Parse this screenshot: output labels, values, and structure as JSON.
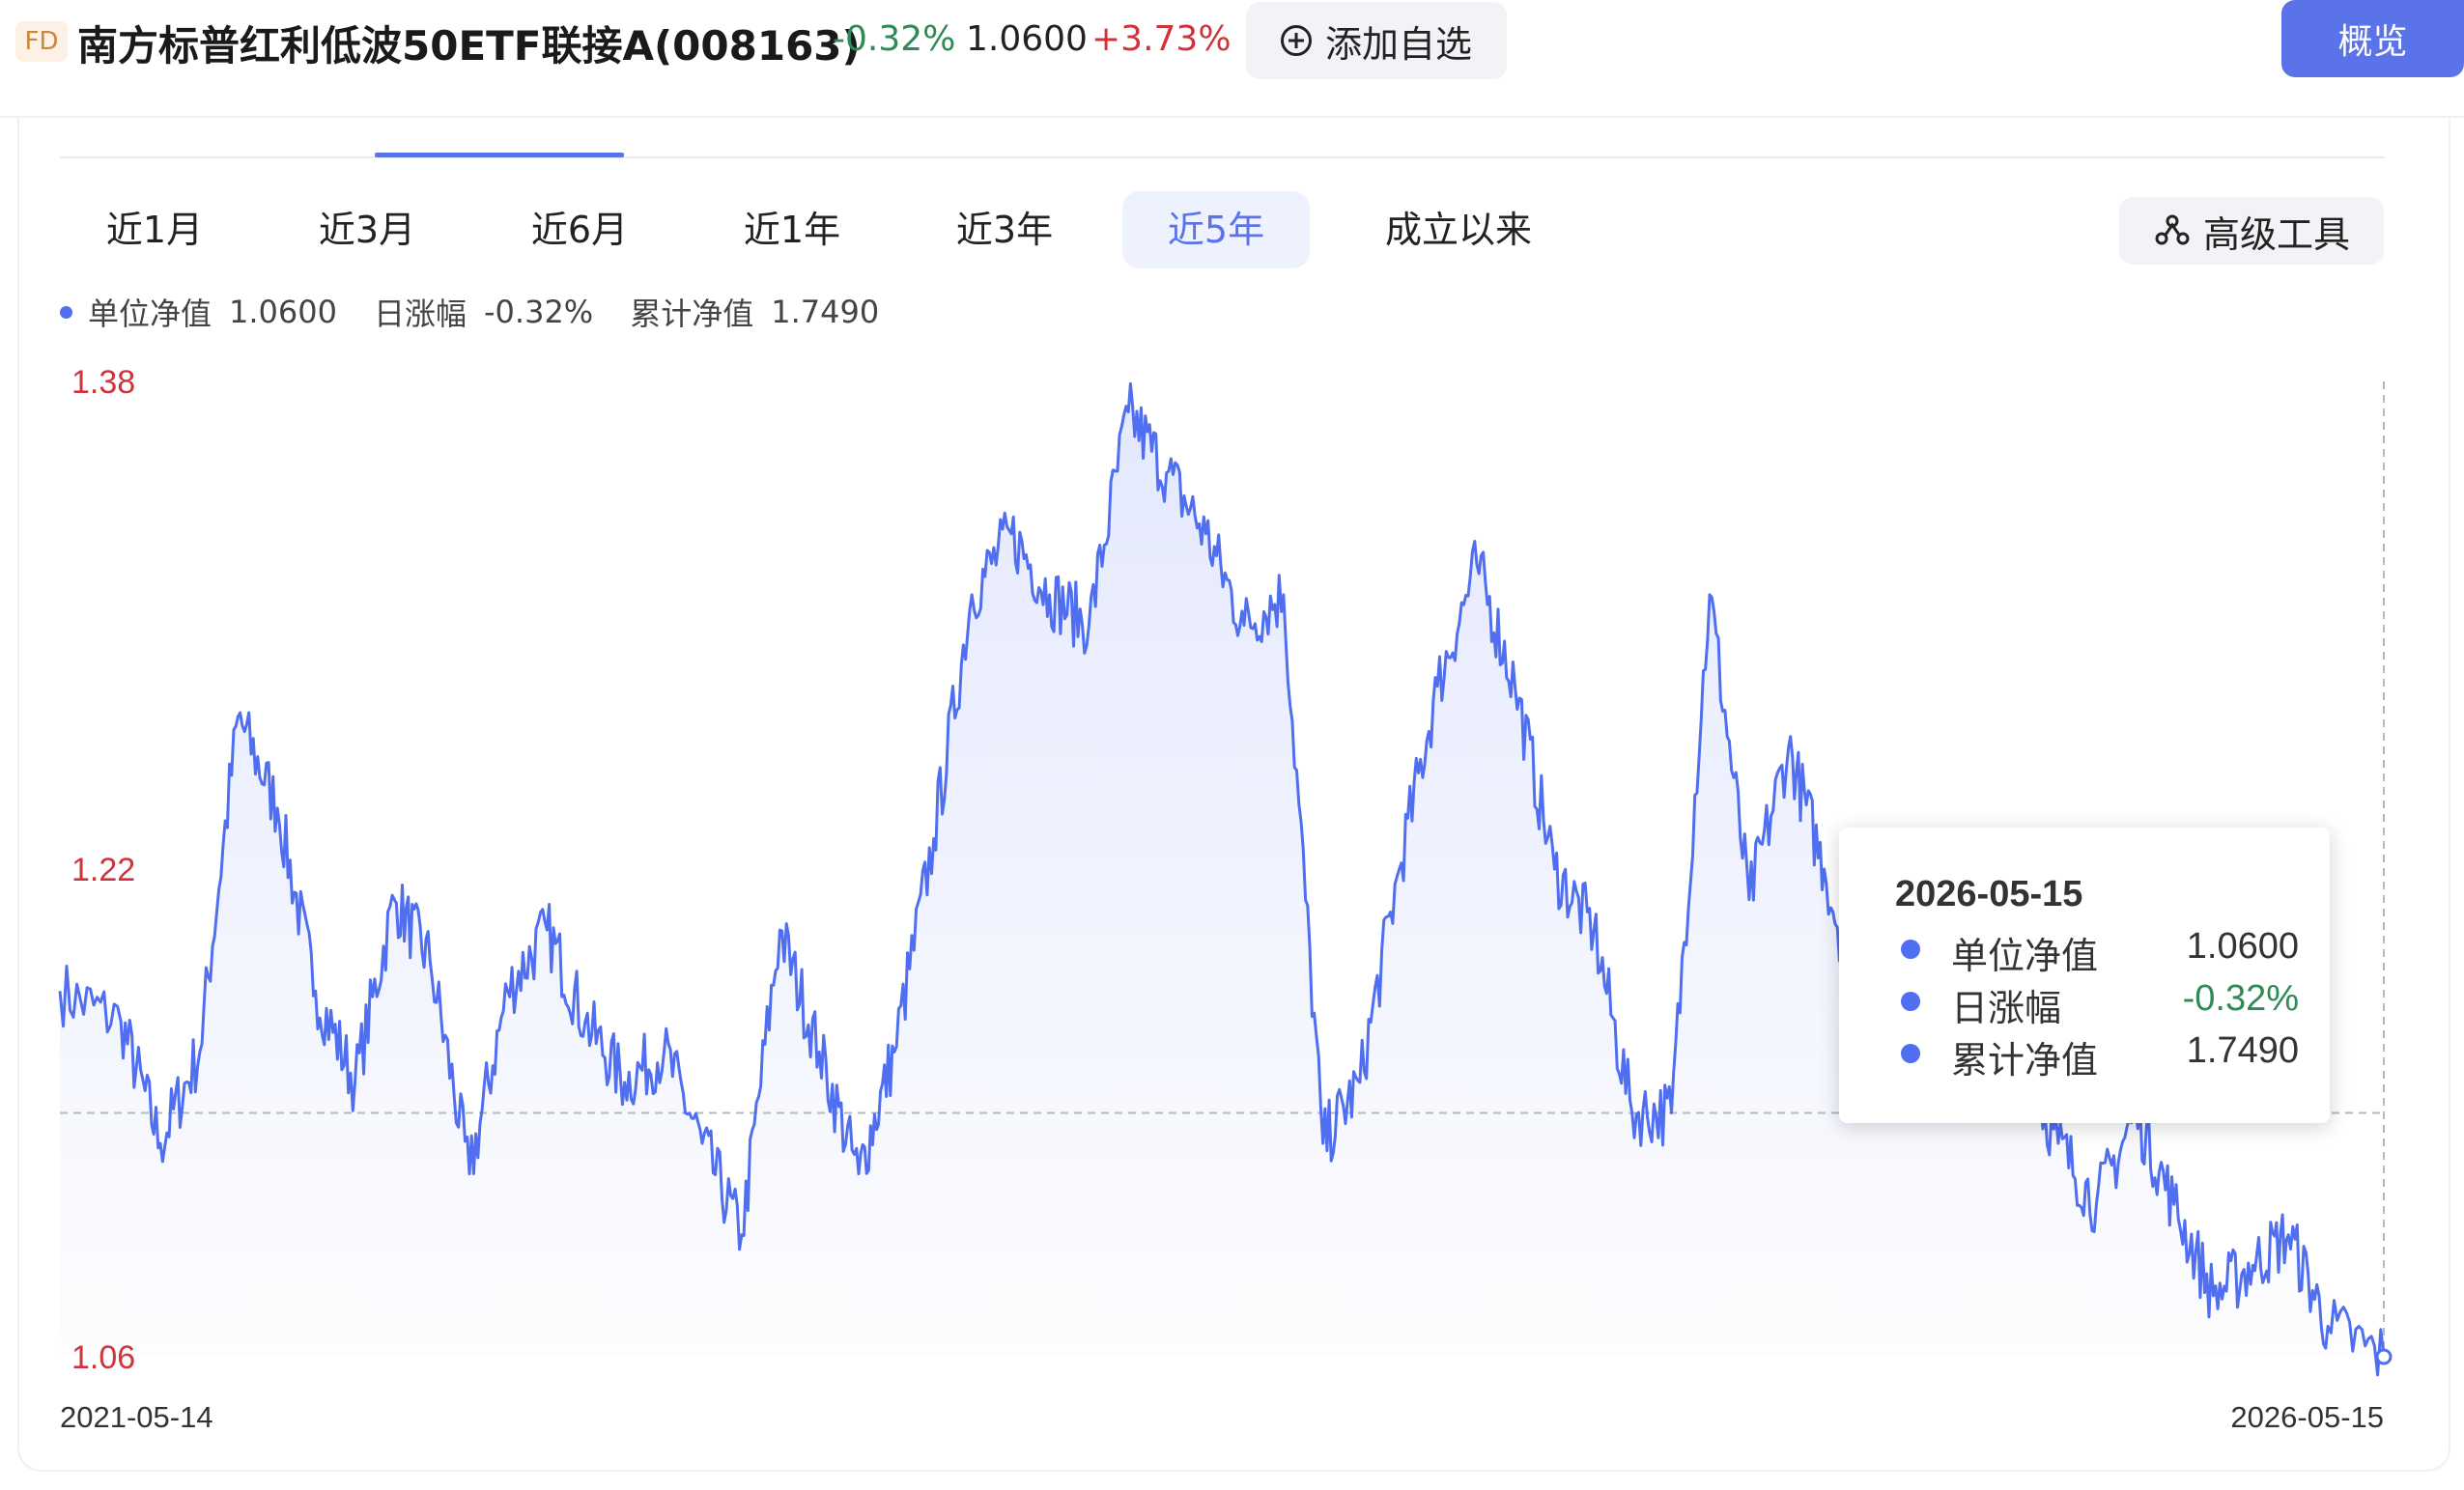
{
  "header": {
    "badge": "FD",
    "fund_title": "南方标普红利低波50ETF联接A(008163)",
    "change_pct": "-0.32%",
    "nav": "1.0600",
    "period_return": "+3.73%",
    "add_watchlist": "添加自选",
    "overview": "概览"
  },
  "range_tabs": [
    {
      "label": "近1月"
    },
    {
      "label": "近3月"
    },
    {
      "label": "近6月"
    },
    {
      "label": "近1年"
    },
    {
      "label": "近3年"
    },
    {
      "label": "近5年",
      "active": true
    },
    {
      "label": "成立以来"
    }
  ],
  "advanced_tool": "高级工具",
  "legend": {
    "unit_nav_label": "单位净值",
    "unit_nav_value": "1.0600",
    "daily_change_label": "日涨幅",
    "daily_change_value": "-0.32%",
    "cum_nav_label": "累计净值",
    "cum_nav_value": "1.7490"
  },
  "tooltip": {
    "date": "2026-05-15",
    "unit_nav_label": "单位净值",
    "unit_nav_value": "1.0600",
    "daily_change_label": "日涨幅",
    "daily_change_value": "-0.32%",
    "cum_nav_label": "累计净值",
    "cum_nav_value": "1.7490"
  },
  "colors": {
    "line": "#4f6ef0",
    "accent": "#5b73e8",
    "up": "#d0333b",
    "down": "#2e8b57"
  },
  "chart_data": {
    "type": "area",
    "series": [
      {
        "x": [
          "2021-05-14",
          "2021-07-01",
          "2021-08-01",
          "2021-09-01",
          "2021-10-01",
          "2021-11-01",
          "2021-12-01",
          "2022-01-01",
          "2022-02-01",
          "2022-03-01",
          "2022-04-01",
          "2022-05-01",
          "2022-06-01",
          "2022-07-01",
          "2022-08-01",
          "2022-09-01",
          "2022-10-01",
          "2022-11-01",
          "2022-12-01",
          "2023-01-01",
          "2023-02-01",
          "2023-03-01",
          "2023-04-01",
          "2023-05-01",
          "2023-06-01",
          "2023-07-01",
          "2023-08-01",
          "2023-09-01",
          "2023-10-01",
          "2023-11-01",
          "2023-12-01",
          "2024-01-01",
          "2024-02-01",
          "2024-03-01",
          "2024-04-01",
          "2024-05-01",
          "2024-06-01",
          "2024-07-01",
          "2024-08-01",
          "2024-09-01",
          "2024-10-01",
          "2024-11-01",
          "2024-12-01",
          "2025-01-01",
          "2025-02-01",
          "2025-03-01",
          "2025-04-01",
          "2025-05-01",
          "2025-06-01",
          "2025-07-01",
          "2025-08-01",
          "2025-09-01",
          "2025-10-01",
          "2025-11-01",
          "2025-12-01",
          "2026-01-01",
          "2026-02-01",
          "2026-03-01",
          "2026-04-01",
          "2026-05-15"
        ],
        "values": [
          1.18,
          1.17,
          1.13,
          1.16,
          1.27,
          1.24,
          1.18,
          1.15,
          1.21,
          1.19,
          1.12,
          1.18,
          1.2,
          1.17,
          1.15,
          1.16,
          1.13,
          1.1,
          1.2,
          1.16,
          1.12,
          1.16,
          1.23,
          1.31,
          1.33,
          1.31,
          1.3,
          1.37,
          1.35,
          1.33,
          1.3,
          1.31,
          1.13,
          1.15,
          1.22,
          1.28,
          1.32,
          1.28,
          1.22,
          1.2,
          1.14,
          1.14,
          1.31,
          1.21,
          1.26,
          1.22,
          1.17,
          1.16,
          1.15,
          1.17,
          1.16,
          1.13,
          1.11,
          1.14,
          1.11,
          1.08,
          1.09,
          1.1,
          1.07,
          1.06
        ]
      }
    ],
    "ylim": [
      1.06,
      1.38
    ],
    "ytick_labels": [
      "1.38",
      "1.22",
      "1.06"
    ],
    "x_start_label": "2021-05-14",
    "x_end_label": "2026-05-15",
    "reference_line": 1.14,
    "grid": false
  }
}
